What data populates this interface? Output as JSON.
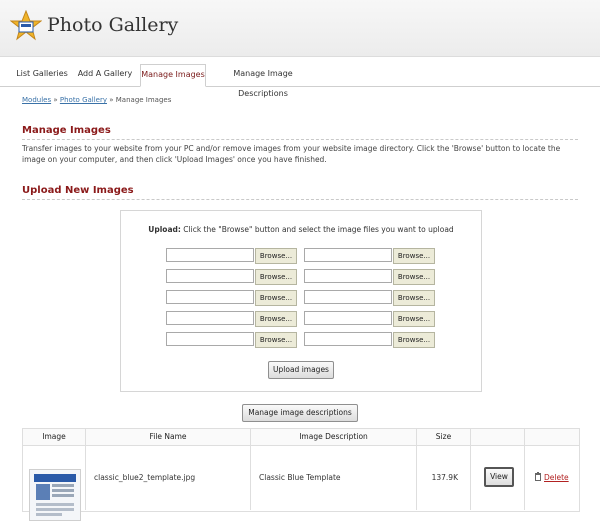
{
  "app": {
    "title": "Photo Gallery"
  },
  "tabs": [
    {
      "label": "List Galleries"
    },
    {
      "label": "Add A Gallery"
    },
    {
      "label": "Manage Images"
    },
    {
      "label": "Manage Image Descriptions"
    }
  ],
  "breadcrumb": {
    "modules": "Modules",
    "sep": "»",
    "gallery": "Photo Gallery",
    "current": "Manage Images"
  },
  "manage": {
    "title": "Manage Images",
    "description": "Transfer images to your website from your PC and/or remove images from your website image directory. Click the 'Browse' button to locate the image on your computer, and then click 'Upload Images' once you have finished."
  },
  "upload": {
    "title": "Upload New Images",
    "instruction_bold": "Upload:",
    "instruction_text": " Click the \"Browse\" button and select the image files you want to upload",
    "browse_label": "Browse...",
    "upload_button": "Upload images",
    "manage_desc_button": "Manage image descriptions"
  },
  "table": {
    "headers": [
      "Image",
      "File Name",
      "Image Description",
      "Size"
    ],
    "rows": [
      {
        "file_name": "classic_blue2_template.jpg",
        "description": "Classic Blue Template",
        "size": "137.9K",
        "view_label": "View",
        "delete_label": "Delete"
      }
    ]
  },
  "icons": {
    "logo": "star-logo-icon",
    "delete": "trash-icon"
  },
  "colors": {
    "heading": "#8b1a1a",
    "link": "#3a72a8",
    "active_tab": "#7a1a1a",
    "delete": "#b22222"
  }
}
